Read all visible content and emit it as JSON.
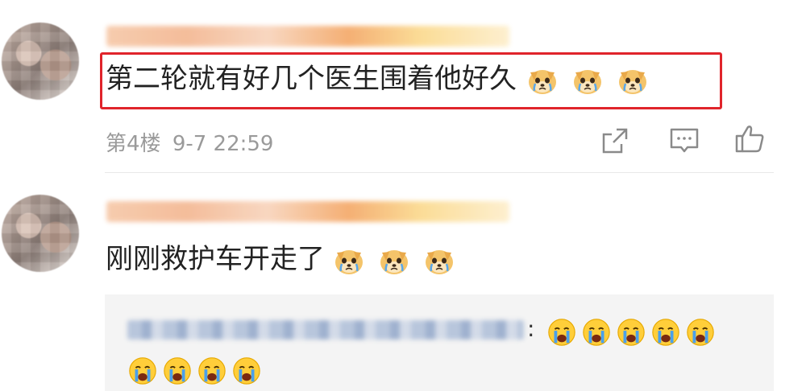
{
  "comments": [
    {
      "text": "第二轮就有好几个医生围着他好久",
      "floor": "第4楼",
      "time": "9-7 22:59",
      "emoji_icon": "dog-crying-emoji",
      "emoji_count": 3
    },
    {
      "text": "刚刚救护车开走了",
      "emoji_icon": "dog-crying-emoji",
      "emoji_count": 3,
      "reply": {
        "colon": ":",
        "emoji_icon": "crying-face-emoji"
      }
    }
  ],
  "actions": {
    "share_icon": "share-icon",
    "comment_icon": "comment-icon",
    "like_icon": "thumbs-up-icon"
  },
  "colors": {
    "highlight": "#e0242b",
    "meta": "#9a9a9a",
    "reply_bg": "#f4f4f4"
  }
}
